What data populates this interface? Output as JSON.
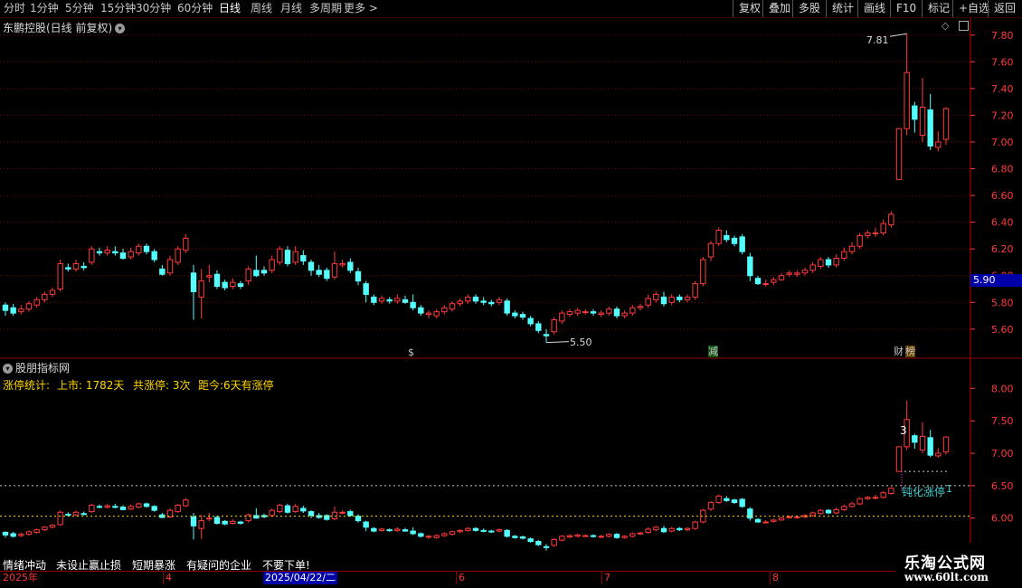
{
  "toolbar": {
    "periods": [
      "分时",
      "1分钟",
      "5分钟",
      "15分钟",
      "30分钟",
      "60分钟",
      "日线",
      "周线",
      "月线",
      "多周期",
      "更多 >"
    ],
    "active_period": "日线",
    "actions": [
      "复权",
      "叠加",
      "多股",
      "统计",
      "画线",
      "F10",
      "标记",
      "+自选",
      "返回"
    ]
  },
  "main_pane": {
    "title": "东鹏控股(日线 前复权)",
    "price_ticks": [
      "7.80",
      "7.60",
      "7.40",
      "7.20",
      "7.00",
      "6.80",
      "6.60",
      "6.40",
      "6.20",
      "6.00",
      "5.80",
      "5.60"
    ],
    "current_price": "5.90",
    "high_label": "7.81",
    "low_label": "5.50",
    "markers": [
      {
        "text": "$",
        "color": "#ff3b3b"
      },
      {
        "text": "减",
        "color": "#33dd33"
      },
      {
        "text": "财",
        "color": "#ffffff"
      },
      {
        "text": "榜",
        "color": "#ffcc00"
      }
    ]
  },
  "indicator_pane": {
    "title": "股朋指标网",
    "stats_label": "涨停统计:",
    "listed": "上市: 1782天",
    "limit_count": "共涨停: 3次",
    "since": "距今:6天有涨停",
    "ticks": [
      "8.00",
      "7.50",
      "7.00",
      "6.50",
      "6.00"
    ],
    "annotation_num": "3",
    "annotation_text": "钝化涨停",
    "annotation_count": "1"
  },
  "tips": [
    "情绪冲动",
    "未设止赢止损",
    "短期暴涨",
    "有疑问的企业",
    "不要下单!"
  ],
  "dates": {
    "year": "2025年",
    "months": [
      "4",
      "5",
      "6",
      "7",
      "8"
    ],
    "selected": "2025/04/22/二"
  },
  "watermark": {
    "title": "乐淘公式网",
    "url": "www.60lt.com"
  },
  "colors": {
    "up": "#ff3b3b",
    "down": "#54ffff",
    "grid": "#8b0000",
    "axis": "#ff3b3b"
  },
  "chart_data": {
    "type": "candlestick",
    "ylim": [
      5.45,
      7.9
    ],
    "candles": [
      [
        5.78,
        5.74,
        5.8,
        5.7
      ],
      [
        5.76,
        5.72,
        5.79,
        5.7
      ],
      [
        5.73,
        5.75,
        5.78,
        5.71
      ],
      [
        5.75,
        5.79,
        5.81,
        5.73
      ],
      [
        5.78,
        5.82,
        5.84,
        5.76
      ],
      [
        5.82,
        5.86,
        5.88,
        5.8
      ],
      [
        5.86,
        5.89,
        5.91,
        5.84
      ],
      [
        5.9,
        6.09,
        6.12,
        5.88
      ],
      [
        6.06,
        6.05,
        6.09,
        6.03
      ],
      [
        6.05,
        6.09,
        6.12,
        6.03
      ],
      [
        6.07,
        6.06,
        6.1,
        6.04
      ],
      [
        6.1,
        6.2,
        6.22,
        6.08
      ],
      [
        6.18,
        6.17,
        6.21,
        6.15
      ],
      [
        6.17,
        6.19,
        6.22,
        6.15
      ],
      [
        6.18,
        6.17,
        6.22,
        6.15
      ],
      [
        6.17,
        6.13,
        6.2,
        6.12
      ],
      [
        6.14,
        6.18,
        6.21,
        6.12
      ],
      [
        6.17,
        6.22,
        6.24,
        6.15
      ],
      [
        6.22,
        6.18,
        6.24,
        6.16
      ],
      [
        6.18,
        6.12,
        6.2,
        6.1
      ],
      [
        6.05,
        6.01,
        6.08,
        6.0
      ],
      [
        6.02,
        6.12,
        6.15,
        6.0
      ],
      [
        6.1,
        6.2,
        6.22,
        6.08
      ],
      [
        6.19,
        6.28,
        6.31,
        6.17
      ],
      [
        6.02,
        5.88,
        6.08,
        5.67
      ],
      [
        5.84,
        5.96,
        6.05,
        5.68
      ],
      [
        5.99,
        6.0,
        6.08,
        5.95
      ],
      [
        6.01,
        5.92,
        6.04,
        5.9
      ],
      [
        5.95,
        5.91,
        5.97,
        5.89
      ],
      [
        5.92,
        5.95,
        5.98,
        5.9
      ],
      [
        5.94,
        5.92,
        5.96,
        5.9
      ],
      [
        5.96,
        6.05,
        6.07,
        5.93
      ],
      [
        6.04,
        6.0,
        6.15,
        5.99
      ],
      [
        6.04,
        6.02,
        6.07,
        6.0
      ],
      [
        6.04,
        6.12,
        6.15,
        6.02
      ],
      [
        6.1,
        6.2,
        6.22,
        6.08
      ],
      [
        6.19,
        6.09,
        6.22,
        6.07
      ],
      [
        6.1,
        6.18,
        6.22,
        6.08
      ],
      [
        6.15,
        6.11,
        6.19,
        6.08
      ],
      [
        6.1,
        6.04,
        6.12,
        6.0
      ],
      [
        6.04,
        6.01,
        6.08,
        5.99
      ],
      [
        6.04,
        5.98,
        6.06,
        5.96
      ],
      [
        5.99,
        6.09,
        6.18,
        5.97
      ],
      [
        6.08,
        6.09,
        6.12,
        6.06
      ],
      [
        6.1,
        6.04,
        6.13,
        6.02
      ],
      [
        6.03,
        5.96,
        6.06,
        5.93
      ],
      [
        5.94,
        5.86,
        5.96,
        5.8
      ],
      [
        5.84,
        5.8,
        5.86,
        5.78
      ],
      [
        5.81,
        5.83,
        5.85,
        5.79
      ],
      [
        5.82,
        5.81,
        5.84,
        5.79
      ],
      [
        5.81,
        5.83,
        5.86,
        5.79
      ],
      [
        5.82,
        5.8,
        5.85,
        5.79
      ],
      [
        5.8,
        5.76,
        5.86,
        5.74
      ],
      [
        5.76,
        5.72,
        5.78,
        5.7
      ],
      [
        5.71,
        5.72,
        5.74,
        5.68
      ],
      [
        5.7,
        5.73,
        5.75,
        5.68
      ],
      [
        5.73,
        5.76,
        5.78,
        5.71
      ],
      [
        5.75,
        5.79,
        5.81,
        5.73
      ],
      [
        5.79,
        5.81,
        5.83,
        5.77
      ],
      [
        5.81,
        5.84,
        5.86,
        5.79
      ],
      [
        5.84,
        5.81,
        5.86,
        5.79
      ],
      [
        5.81,
        5.8,
        5.84,
        5.78
      ],
      [
        5.8,
        5.79,
        5.82,
        5.77
      ],
      [
        5.8,
        5.82,
        5.84,
        5.78
      ],
      [
        5.81,
        5.72,
        5.83,
        5.7
      ],
      [
        5.72,
        5.7,
        5.74,
        5.68
      ],
      [
        5.71,
        5.69,
        5.73,
        5.67
      ],
      [
        5.68,
        5.64,
        5.7,
        5.62
      ],
      [
        5.64,
        5.59,
        5.66,
        5.57
      ],
      [
        5.56,
        5.55,
        5.6,
        5.5
      ],
      [
        5.58,
        5.67,
        5.69,
        5.56
      ],
      [
        5.66,
        5.72,
        5.74,
        5.64
      ],
      [
        5.71,
        5.73,
        5.75,
        5.69
      ],
      [
        5.72,
        5.74,
        5.76,
        5.7
      ],
      [
        5.73,
        5.73,
        5.75,
        5.71
      ],
      [
        5.73,
        5.72,
        5.75,
        5.7
      ],
      [
        5.71,
        5.72,
        5.74,
        5.69
      ],
      [
        5.72,
        5.75,
        5.77,
        5.7
      ],
      [
        5.75,
        5.7,
        5.77,
        5.68
      ],
      [
        5.7,
        5.72,
        5.74,
        5.68
      ],
      [
        5.72,
        5.76,
        5.78,
        5.7
      ],
      [
        5.76,
        5.77,
        5.79,
        5.74
      ],
      [
        5.78,
        5.83,
        5.86,
        5.76
      ],
      [
        5.82,
        5.86,
        5.88,
        5.8
      ],
      [
        5.84,
        5.79,
        5.88,
        5.77
      ],
      [
        5.8,
        5.84,
        5.86,
        5.78
      ],
      [
        5.84,
        5.82,
        5.86,
        5.8
      ],
      [
        5.82,
        5.84,
        5.86,
        5.8
      ],
      [
        5.84,
        5.94,
        5.96,
        5.82
      ],
      [
        5.94,
        6.12,
        6.14,
        5.92
      ],
      [
        6.14,
        6.24,
        6.26,
        6.11
      ],
      [
        6.24,
        6.34,
        6.36,
        6.22
      ],
      [
        6.3,
        6.27,
        6.34,
        6.25
      ],
      [
        6.28,
        6.24,
        6.3,
        6.22
      ],
      [
        6.29,
        6.18,
        6.31,
        6.16
      ],
      [
        6.14,
        6.0,
        6.17,
        5.96
      ],
      [
        5.98,
        5.94,
        6.0,
        5.93
      ],
      [
        5.94,
        5.94,
        5.97,
        5.92
      ],
      [
        5.95,
        5.97,
        5.99,
        5.93
      ],
      [
        5.97,
        6.0,
        6.02,
        5.96
      ],
      [
        6.01,
        6.02,
        6.04,
        5.99
      ],
      [
        6.01,
        6.02,
        6.04,
        5.99
      ],
      [
        6.02,
        6.04,
        6.06,
        6.0
      ],
      [
        6.04,
        6.08,
        6.1,
        6.02
      ],
      [
        6.07,
        6.12,
        6.14,
        6.05
      ],
      [
        6.12,
        6.08,
        6.14,
        6.06
      ],
      [
        6.08,
        6.13,
        6.16,
        6.06
      ],
      [
        6.13,
        6.18,
        6.21,
        6.11
      ],
      [
        6.18,
        6.22,
        6.25,
        6.16
      ],
      [
        6.22,
        6.3,
        6.32,
        6.2
      ],
      [
        6.3,
        6.32,
        6.34,
        6.28
      ],
      [
        6.32,
        6.32,
        6.36,
        6.29
      ],
      [
        6.32,
        6.39,
        6.42,
        6.3
      ],
      [
        6.38,
        6.46,
        6.48,
        6.36
      ],
      [
        6.72,
        7.1,
        7.1,
        6.72
      ],
      [
        7.1,
        7.52,
        7.81,
        7.05
      ],
      [
        7.27,
        7.17,
        7.3,
        7.07
      ],
      [
        7.05,
        7.26,
        7.48,
        7.0
      ],
      [
        7.24,
        6.97,
        7.36,
        6.94
      ],
      [
        6.96,
        7.0,
        7.08,
        6.93
      ],
      [
        7.02,
        7.25,
        7.26,
        6.98
      ]
    ]
  }
}
